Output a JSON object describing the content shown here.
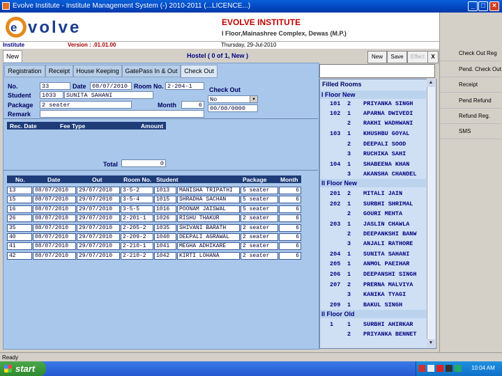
{
  "window": {
    "title": "Evolve Institute - Institute Management System (-) 2010-2011 (...LICENCE...)"
  },
  "header": {
    "logo_text": "evolve",
    "institute_name": "EVOLVE INSTITUTE",
    "address": "I Floor,Mainashree Complex, Dewas (M.P.)",
    "info_label": "Institute",
    "version": "Version : .01.01.00",
    "date": "Thursday, 29-Jul-2010"
  },
  "toolbar": {
    "new_tab": "New",
    "form_title": "Hostel  ( 0 of 1, New )",
    "new_label": "New",
    "save_label": "Save",
    "effect_label": "Effect",
    "close_label": "X"
  },
  "tabs": [
    "Registration",
    "Receipt",
    "House Keeping",
    "GatePass In & Out",
    "Check Out"
  ],
  "form": {
    "no_label": "No.",
    "no_value": "33",
    "date_label": "Date",
    "date_value": "08/07/2010",
    "room_label": "Room No.",
    "room_value": "2-204-1",
    "student_label": "Student",
    "student_id": "1033",
    "student_name": "SUNITA SAHANI",
    "package_label": "Package",
    "package_value": "2 seater",
    "month_label": "Month",
    "month_value": "6",
    "remark_label": "Remark",
    "checkout_label": "Check Out",
    "checkout_select": "No",
    "checkout_date": "00/00/0000"
  },
  "fee_grid": {
    "headers": [
      "Rec. Date",
      "Fee Type",
      "Amount"
    ],
    "total_label": "Total",
    "total_value": "0"
  },
  "room_grid": {
    "headers": [
      "No.",
      "Date",
      "Out",
      "Room No.",
      "Student",
      "Package",
      "Month"
    ],
    "rows": [
      [
        "13",
        "08/07/2010",
        "29/07/2010",
        "3-5-2",
        "1013",
        "MANISHA TRIPATHI",
        "5 seater",
        "6"
      ],
      [
        "15",
        "08/07/2010",
        "29/07/2010",
        "3-5-4",
        "1015",
        "SHRADHA SACHAN",
        "5 seater",
        "6"
      ],
      [
        "16",
        "08/07/2010",
        "29/07/2010",
        "3-5-5",
        "1016",
        "POONAM JAISWAL",
        "5 seater",
        "6"
      ],
      [
        "26",
        "08/07/2010",
        "29/07/2010",
        "2-201-1",
        "1026",
        "RISHU THAKUR",
        "2 seater",
        "6"
      ],
      [
        "35",
        "08/07/2010",
        "29/07/2010",
        "2-205-2",
        "1035",
        "SHIVANI BARATH",
        "2 seater",
        "6"
      ],
      [
        "40",
        "08/07/2010",
        "29/07/2010",
        "2-209-2",
        "1040",
        "DEEPALI AGRAWAL",
        "2 seater",
        "6"
      ],
      [
        "41",
        "08/07/2010",
        "29/07/2010",
        "2-210-1",
        "1041",
        "MEGHA ADHIKARE",
        "2 seater",
        "6"
      ],
      [
        "42",
        "08/07/2010",
        "29/07/2010",
        "2-210-2",
        "1042",
        "KIRTI LOHANA",
        "2 seater",
        "6"
      ]
    ]
  },
  "filled_rooms": {
    "title": "Filled Rooms",
    "items": [
      {
        "type": "floor",
        "label": "I Floor New"
      },
      {
        "room": "101",
        "bed": "2",
        "name": "PRIYANKA SINGH"
      },
      {
        "room": "102",
        "bed": "1",
        "name": "APARNA DWIVEDI"
      },
      {
        "room": "",
        "bed": "2",
        "name": "RAKHI WADHWANI"
      },
      {
        "room": "103",
        "bed": "1",
        "name": "KHUSHBU GOYAL"
      },
      {
        "room": "",
        "bed": "2",
        "name": "DEEPALI SOOD"
      },
      {
        "room": "",
        "bed": "3",
        "name": "RUCHIKA SAHI"
      },
      {
        "room": "104",
        "bed": "1",
        "name": "SHABEENA KHAN"
      },
      {
        "room": "",
        "bed": "3",
        "name": "AKANSHA CHANDEL"
      },
      {
        "type": "floor",
        "label": "II Floor New"
      },
      {
        "room": "201",
        "bed": "2",
        "name": "MITALI JAIN"
      },
      {
        "room": "202",
        "bed": "1",
        "name": "SURBHI SHRIMAL"
      },
      {
        "room": "",
        "bed": "2",
        "name": "GOURI MEHTA"
      },
      {
        "room": "203",
        "bed": "1",
        "name": "JASLIN CHAWLA"
      },
      {
        "room": "",
        "bed": "2",
        "name": "DEEPANKSHI BANW"
      },
      {
        "room": "",
        "bed": "3",
        "name": "ANJALI RATHORE"
      },
      {
        "room": "204",
        "bed": "1",
        "name": "SUNITA SAHANI"
      },
      {
        "room": "205",
        "bed": "1",
        "name": "ANMOL PAEIHAR"
      },
      {
        "room": "206",
        "bed": "1",
        "name": "DEEPANSHI SINGH"
      },
      {
        "room": "207",
        "bed": "2",
        "name": "PRERNA MALVIYA"
      },
      {
        "room": "",
        "bed": "3",
        "name": "KANIKA TYAGI"
      },
      {
        "room": "209",
        "bed": "1",
        "name": "BAKUL SINGH"
      },
      {
        "type": "floor",
        "label": "II Floor Old"
      },
      {
        "room": "1",
        "bed": "1",
        "name": "SURBHI AHIRKAR"
      },
      {
        "room": "",
        "bed": "2",
        "name": "PRIYANKA BENNET"
      }
    ]
  },
  "side_menu": [
    "Check Out Reg",
    "Pend. Check Out",
    "Receipt",
    "Pend Refund",
    "Refund Reg.",
    "SMS"
  ],
  "status": {
    "text": "Ready"
  },
  "taskbar": {
    "start": "start",
    "clock": "10:04 AM"
  },
  "colors": {
    "grid_header": "#1e3c78",
    "panel_blue": "#a9c7ea",
    "brand_red": "#c00000"
  }
}
